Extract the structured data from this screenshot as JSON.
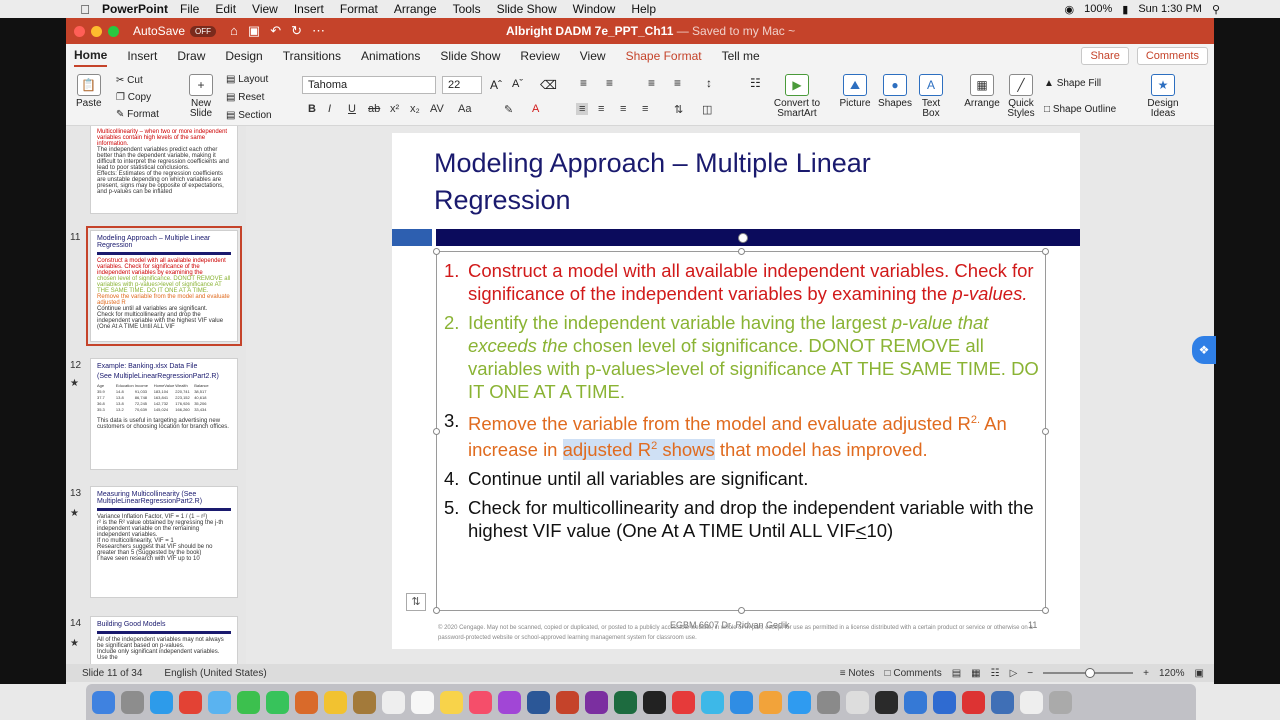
{
  "menubar": {
    "app": "PowerPoint",
    "items": [
      "File",
      "Edit",
      "View",
      "Insert",
      "Format",
      "Arrange",
      "Tools",
      "Slide Show",
      "Window",
      "Help"
    ],
    "battery": "100%",
    "time": "Sun 1:30 PM"
  },
  "titlebar": {
    "autosave": "AutoSave",
    "toggle": "OFF",
    "doc_name": "Albright DADM 7e_PPT_Ch11",
    "saved": "— Saved to my Mac ~"
  },
  "tabs": [
    "Home",
    "Insert",
    "Draw",
    "Design",
    "Transitions",
    "Animations",
    "Slide Show",
    "Review",
    "View",
    "Shape Format",
    "Tell me"
  ],
  "share": {
    "share": "Share",
    "comments": "Comments"
  },
  "ribbon": {
    "paste": "Paste",
    "cut": "Cut",
    "copy": "Copy",
    "format": "Format",
    "new_slide": "New Slide",
    "layout": "Layout",
    "reset": "Reset",
    "section": "Section",
    "font": "Tahoma",
    "size": "22",
    "convert": "Convert to SmartArt",
    "picture": "Picture",
    "shapes": "Shapes",
    "text_box": "Text Box",
    "arrange": "Arrange",
    "quick_styles": "Quick Styles",
    "shape_fill": "Shape Fill",
    "shape_outline": "Shape Outline",
    "design_ideas": "Design Ideas"
  },
  "thumbs": {
    "t10_lines": [
      "Multicollinearity – when two or more independent variables contain high levels of the same information.",
      "The independent variables predict each other better than the dependent variable, making it difficult to interpret the regression coefficients and lead to poor statistical conclusions.",
      "Effects: Estimates of the regression coefficients are unstable depending on which variables are present, signs may be opposite of expectations, and p-values can be inflated"
    ],
    "n11": "11",
    "t11_title": "Modeling Approach – Multiple Linear Regression",
    "n12": "12",
    "t12_title": "Example: Banking.xlsx Data File",
    "t12_sub": "(See MultipleLinearRegressionPart2.R)",
    "t12_note": "This data is useful in targeting advertising new customers or choosing location for branch offices.",
    "n13": "13",
    "t13_title": "Measuring Multicollinearity (See MultipleLinearRegressionPart2.R)",
    "t13_lines": [
      "Variance Inflation Factor, VIF = 1 / (1 − r²)",
      "r² is the R² value obtained by regressing the j-th independent variable on the remaining independent variables.",
      "If no multicollinearity, VIF = 1",
      "Researchers suggest that VIF should be no greater than 5 (Suggested by the book)",
      "I have seen research with VIF up to 10"
    ],
    "n14": "14",
    "t14_title": "Building Good Models",
    "t14_lines": [
      "All of the independent variables may not always be significant based on p-values.",
      "Include only significant independent variables. Use the"
    ]
  },
  "slide": {
    "title_line1": "Modeling Approach – Multiple Linear",
    "title_line2": "Regression",
    "i1_num": "1.",
    "i1_a": "Construct a model with all available independent variables. Check for significance of the independent variables by examining the ",
    "i1_b": "p-values.",
    "i2_num": "2.",
    "i2_a": "Identify the independent variable having the largest ",
    "i2_b": "p-value that exceeds the",
    "i2_c": " chosen level of significance. DONOT REMOVE all variables with p-values>level of significance AT THE SAME TIME. DO IT ONE AT A TIME.",
    "i3_num": "3.",
    "i3_a": "Remove the variable from the model and evaluate adjusted R",
    "i3_sup": "2.",
    "i3_b": " An increase in ",
    "i3_hl": "adjusted R",
    "i3_hl_sup": "2",
    "i3_hl2": " shows",
    "i3_c": " that model has improved.",
    "i4_num": "4.",
    "i4": "Continue until all variables are significant.",
    "i5_num": "5.",
    "i5_a": "Check for multicollinearity and drop the independent variable with the highest VIF value (One At A TIME Until ALL VIF",
    "i5_le": "<",
    "i5_b": "10)",
    "footer": "© 2020 Cengage. May not be scanned, copied or duplicated, or posted to a publicly accessible website, in whole or in part, except for use as permitted in a license distributed with a certain product or service or otherwise on a password-protected website or school-approved learning management system for classroom use.",
    "prof": "EGBM 6607 Dr. Ridvan Gedik",
    "page": "11"
  },
  "status": {
    "slide": "Slide 11 of 34",
    "lang": "English (United States)",
    "notes": "Notes",
    "comments": "Comments",
    "zoom": "120%"
  },
  "colors": {
    "titlebar": "#c5432a",
    "navy": "#0b0b5c",
    "red_text": "#d11a1a",
    "green_text": "#8ab334",
    "orange_text": "#e06b1f"
  }
}
